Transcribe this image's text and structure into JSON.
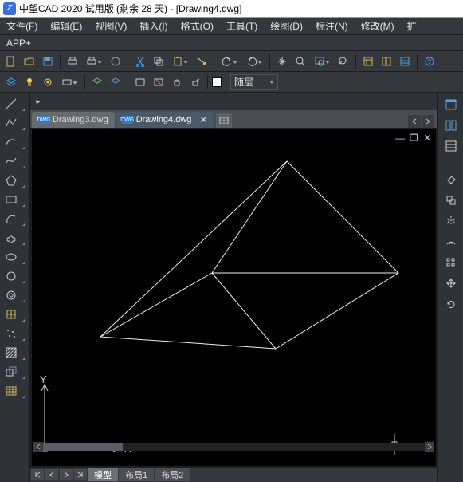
{
  "title": "中望CAD 2020 试用版 (剩余 28 天) - [Drawing4.dwg]",
  "menu": [
    "文件(F)",
    "编辑(E)",
    "视图(V)",
    "插入(I)",
    "格式(O)",
    "工具(T)",
    "绘图(D)",
    "标注(N)",
    "修改(M)",
    "扩"
  ],
  "appplus": "APP+",
  "layer": {
    "label": "随层"
  },
  "tabs": [
    {
      "name": "Drawing3.dwg",
      "active": false
    },
    {
      "name": "Drawing4.dwg",
      "active": true
    }
  ],
  "axes": {
    "y": "Y",
    "x": "X"
  },
  "layout_tabs": [
    "模型",
    "布局1",
    "布局2"
  ],
  "layout_active": 0
}
